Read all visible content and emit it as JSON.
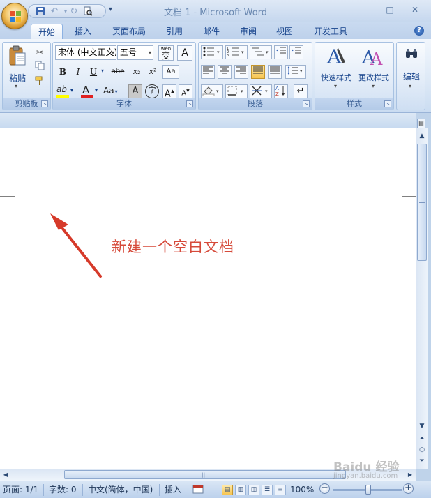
{
  "window": {
    "title": "文档 1 - Microsoft Word",
    "controls": {
      "minimize": "–",
      "maximize": "□",
      "close": "✕"
    }
  },
  "quick_access": {
    "items": [
      "save-icon",
      "undo-icon",
      "redo-icon",
      "print-preview-icon"
    ],
    "customize_glyph": "▾"
  },
  "tabs": [
    {
      "label": "开始",
      "active": true
    },
    {
      "label": "插入"
    },
    {
      "label": "页面布局"
    },
    {
      "label": "引用"
    },
    {
      "label": "邮件"
    },
    {
      "label": "审阅"
    },
    {
      "label": "视图"
    },
    {
      "label": "开发工具"
    }
  ],
  "help_glyph": "?",
  "ribbon": {
    "clipboard": {
      "label": "剪贴板",
      "paste_label": "粘贴",
      "paste_arrow": "▾"
    },
    "font": {
      "label": "字体",
      "font_name": "宋体 (中文正文)",
      "font_size": "五号",
      "phonetic_top": "wén",
      "phonetic_char": "变",
      "border_char": "A",
      "bold": "B",
      "italic": "I",
      "underline": "U",
      "strikethrough": "abe",
      "subscript": "x₂",
      "superscript": "x²",
      "clear_format": "Aa",
      "font_color": "A",
      "change_case": "Aa",
      "char_shading": "A",
      "enclose_char": "字",
      "grow": "A",
      "shrink": "A"
    },
    "paragraph": {
      "label": "段落"
    },
    "styles": {
      "label": "样式",
      "quick_styles": "快速样式",
      "change_styles": "更改样式"
    },
    "editing": {
      "label": "编辑"
    }
  },
  "document": {
    "annotation": "新建一个空白文档"
  },
  "statusbar": {
    "page": "页面: 1/1",
    "words": "字数: 0",
    "language": "中文(简体，中国)",
    "insert_mode": "插入",
    "zoom": "100%",
    "zoom_out": "−",
    "zoom_in": "+"
  },
  "watermark": {
    "text": "Baidu 经验",
    "url": "jingyan.baidu.com"
  },
  "colors": {
    "accent": "#15428b",
    "annotation": "#d64a3a",
    "arrow": "#d63a2a",
    "font_color_bar": "#e02020",
    "highlight_bar": "#ffff00"
  }
}
